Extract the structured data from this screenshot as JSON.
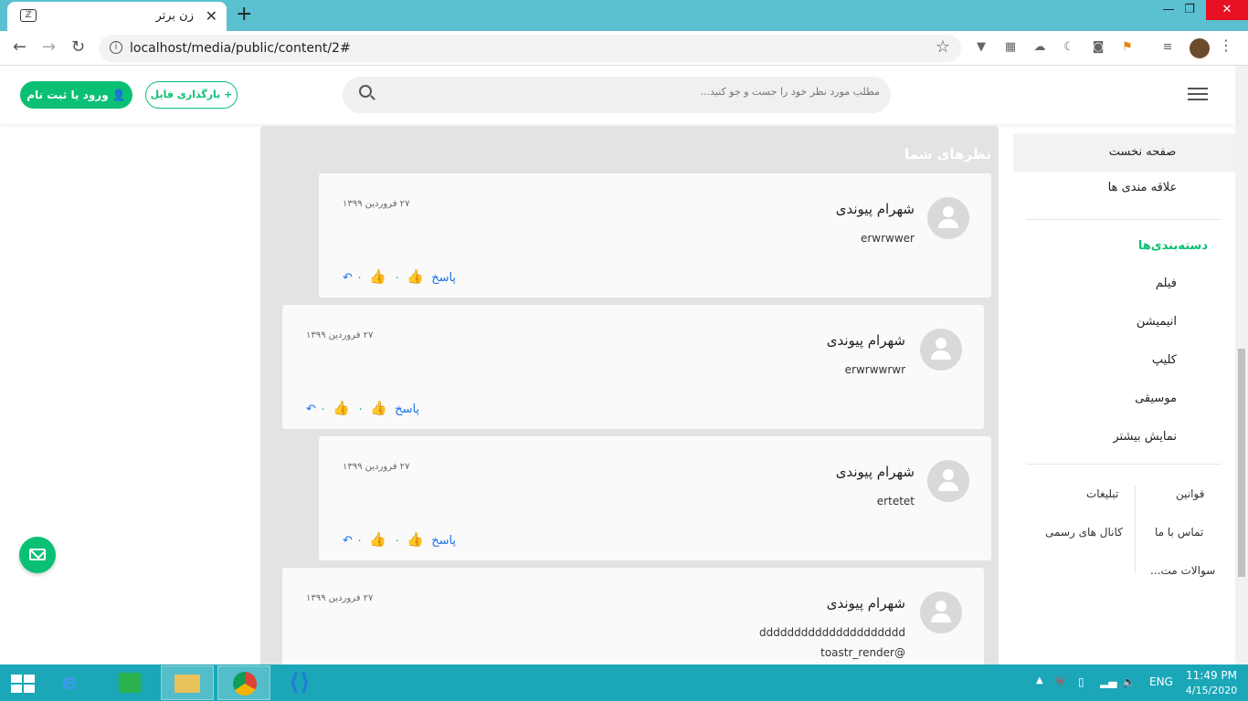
{
  "browser": {
    "tab_title": "زن برتر",
    "url": "localhost/media/public/content/2#"
  },
  "header": {
    "search_placeholder": "مطلب مورد نظر خود را جست و جو کنید...",
    "upload_label": "+ بارگذاری فایل",
    "login_label": "ورود یا ثبت نام"
  },
  "sidebar": {
    "home": "صفحه نخست",
    "favorites": "علاقه مندی ها",
    "categories_title": "دسته‌بندی‌ها",
    "categories": [
      "فیلم",
      "انیمیشن",
      "کلیپ",
      "موسیقی",
      "نمایش بیشتر"
    ],
    "footer_right": [
      "قوانین",
      "تماس با ما",
      "سوالات مت..."
    ],
    "footer_left": [
      "تبلیغات",
      "کانال های رسمی"
    ]
  },
  "comments": {
    "title": "نظرهای شما",
    "reply_label": "پاسخ",
    "items": [
      {
        "name": "شهرام پیوندی",
        "date": "۲۷ فروردین ۱۳۹۹",
        "text": "erwrwwer",
        "likes": "۰",
        "dislikes": "۰"
      },
      {
        "name": "شهرام پیوندی",
        "date": "۲۷ فروردین ۱۳۹۹",
        "text": "erwrwwrwr",
        "likes": "۰",
        "dislikes": "۰"
      },
      {
        "name": "شهرام پیوندی",
        "date": "۲۷ فروردین ۱۳۹۹",
        "text": "ertetet",
        "likes": "۰",
        "dislikes": "۰"
      },
      {
        "name": "شهرام پیوندی",
        "date": "۲۷ فروردین ۱۳۹۹",
        "text": "ddddddddddddddddddddd",
        "text2": "toastr_render@"
      }
    ]
  },
  "taskbar": {
    "lang": "ENG",
    "time": "11:49 PM",
    "date": "4/15/2020"
  },
  "colors": {
    "accent": "#0ac074",
    "titlebar": "#5bc0d0",
    "taskbar": "#1ba7b8"
  }
}
